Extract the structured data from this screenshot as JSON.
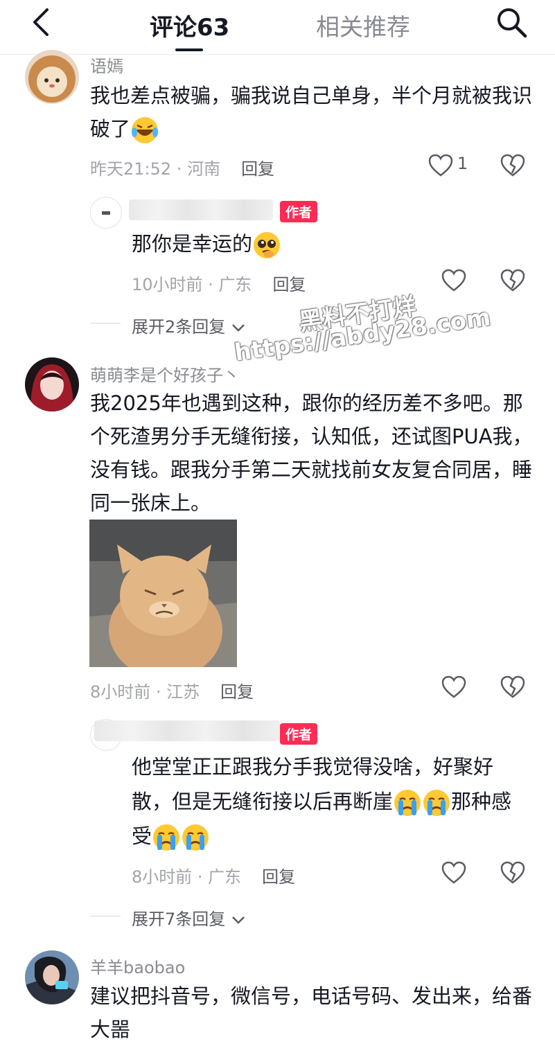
{
  "header": {
    "tab_comments": "评论63",
    "tab_related": "相关推荐"
  },
  "comments": [
    {
      "username": "语嫣",
      "text": "我也差点被骗，骗我说自己单身，半个月就被我识破了",
      "emoji": "laugh-cry-emoji",
      "time": "昨天21:52",
      "location": "河南",
      "reply_label": "回复",
      "like_count": "1",
      "replies": [
        {
          "badge": "作者",
          "text": "那你是幸运的",
          "emoji": "pleading-emoji",
          "time": "10小时前",
          "location": "广东",
          "reply_label": "回复"
        }
      ],
      "expand_label": "展开2条回复"
    },
    {
      "username": "萌萌李是个好孩子丶",
      "text": "我2025年也遇到这种，跟你的经历差不多吧。那个死渣男分手无缝衔接，认知低，还试图PUA我，没有钱。跟我分手第二天就找前女友复合同居，睡同一张床上。",
      "image": "grumpy-cat-meme",
      "time": "8小时前",
      "location": "江苏",
      "reply_label": "回复",
      "replies": [
        {
          "badge": "作者",
          "text": "他堂堂正正跟我分手我觉得没啥，好聚好散，但是无缝衔接以后再断崖",
          "text_mid": "那种感受",
          "emoji": "crying-emoji",
          "time": "8小时前",
          "location": "广东",
          "reply_label": "回复"
        }
      ],
      "expand_label": "展开7条回复"
    },
    {
      "username": "羊羊baobao",
      "text": "建议把抖音号，微信号，电话号码、发出来，给番大噐"
    }
  ],
  "watermark": {
    "line1": "黑料不打烊",
    "line2": "https://abdy28.com"
  },
  "colors": {
    "author_badge": "#fe2c55",
    "secondary_text": "#8a8b91"
  }
}
